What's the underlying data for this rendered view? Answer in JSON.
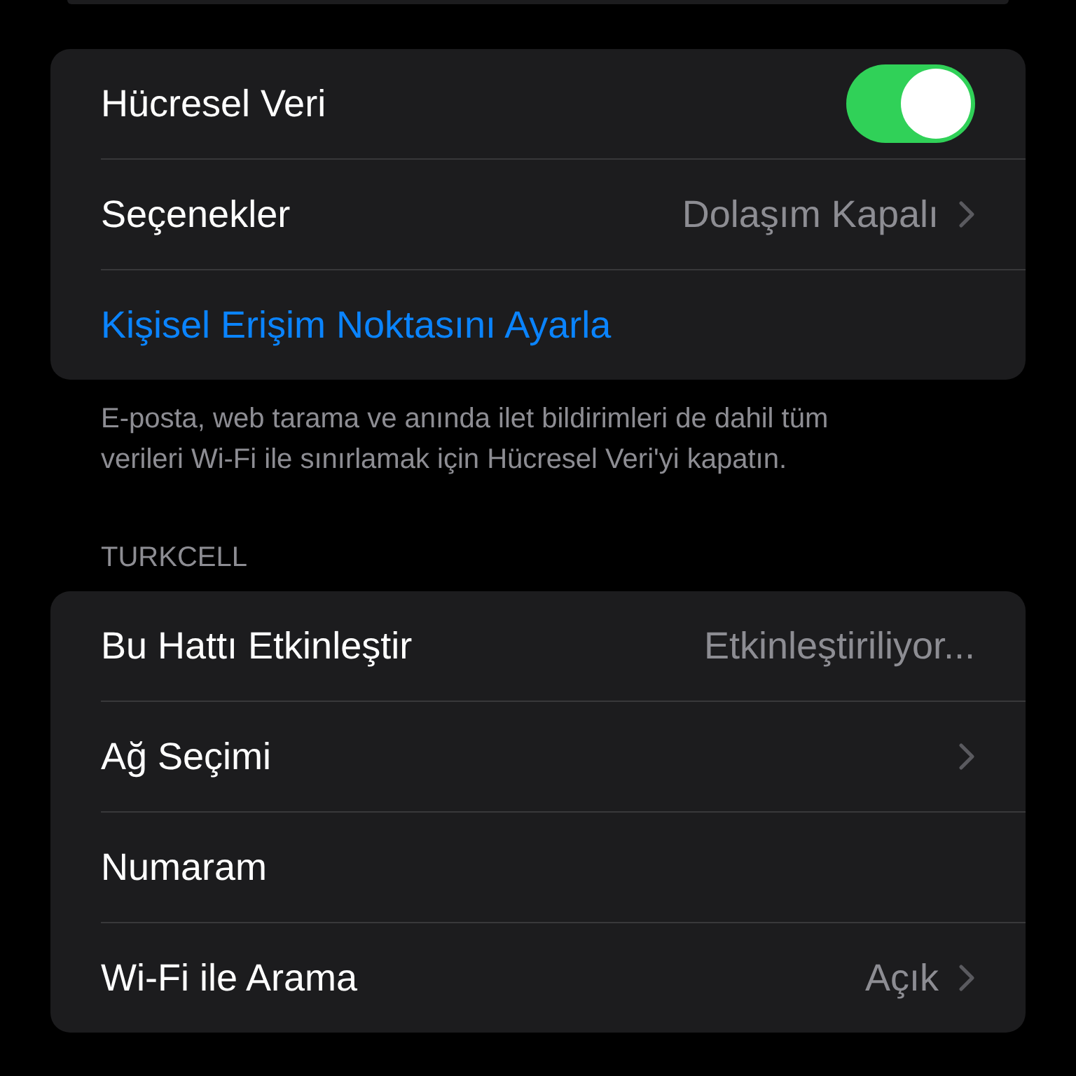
{
  "groups": [
    {
      "rows": [
        {
          "kind": "toggle",
          "label": "Hücresel Veri",
          "on": true
        },
        {
          "kind": "detail",
          "label": "Seçenekler",
          "value": "Dolaşım Kapalı",
          "chevron": true
        },
        {
          "kind": "link",
          "label": "Kişisel Erişim Noktasını Ayarla"
        }
      ],
      "footer": "E-posta, web tarama ve anında ilet bildirimleri de dahil tüm verileri Wi-Fi ile sınırlamak için Hücresel Veri'yi kapatın."
    },
    {
      "header": "TURKCELL",
      "rows": [
        {
          "kind": "detail",
          "label": "Bu Hattı Etkinleştir",
          "value": "Etkinleştiriliyor...",
          "chevron": false
        },
        {
          "kind": "detail",
          "label": "Ağ Seçimi",
          "chevron": true
        },
        {
          "kind": "detail",
          "label": "Numaram",
          "chevron": false
        },
        {
          "kind": "detail",
          "label": "Wi-Fi ile Arama",
          "value": "Açık",
          "chevron": true
        }
      ]
    }
  ]
}
